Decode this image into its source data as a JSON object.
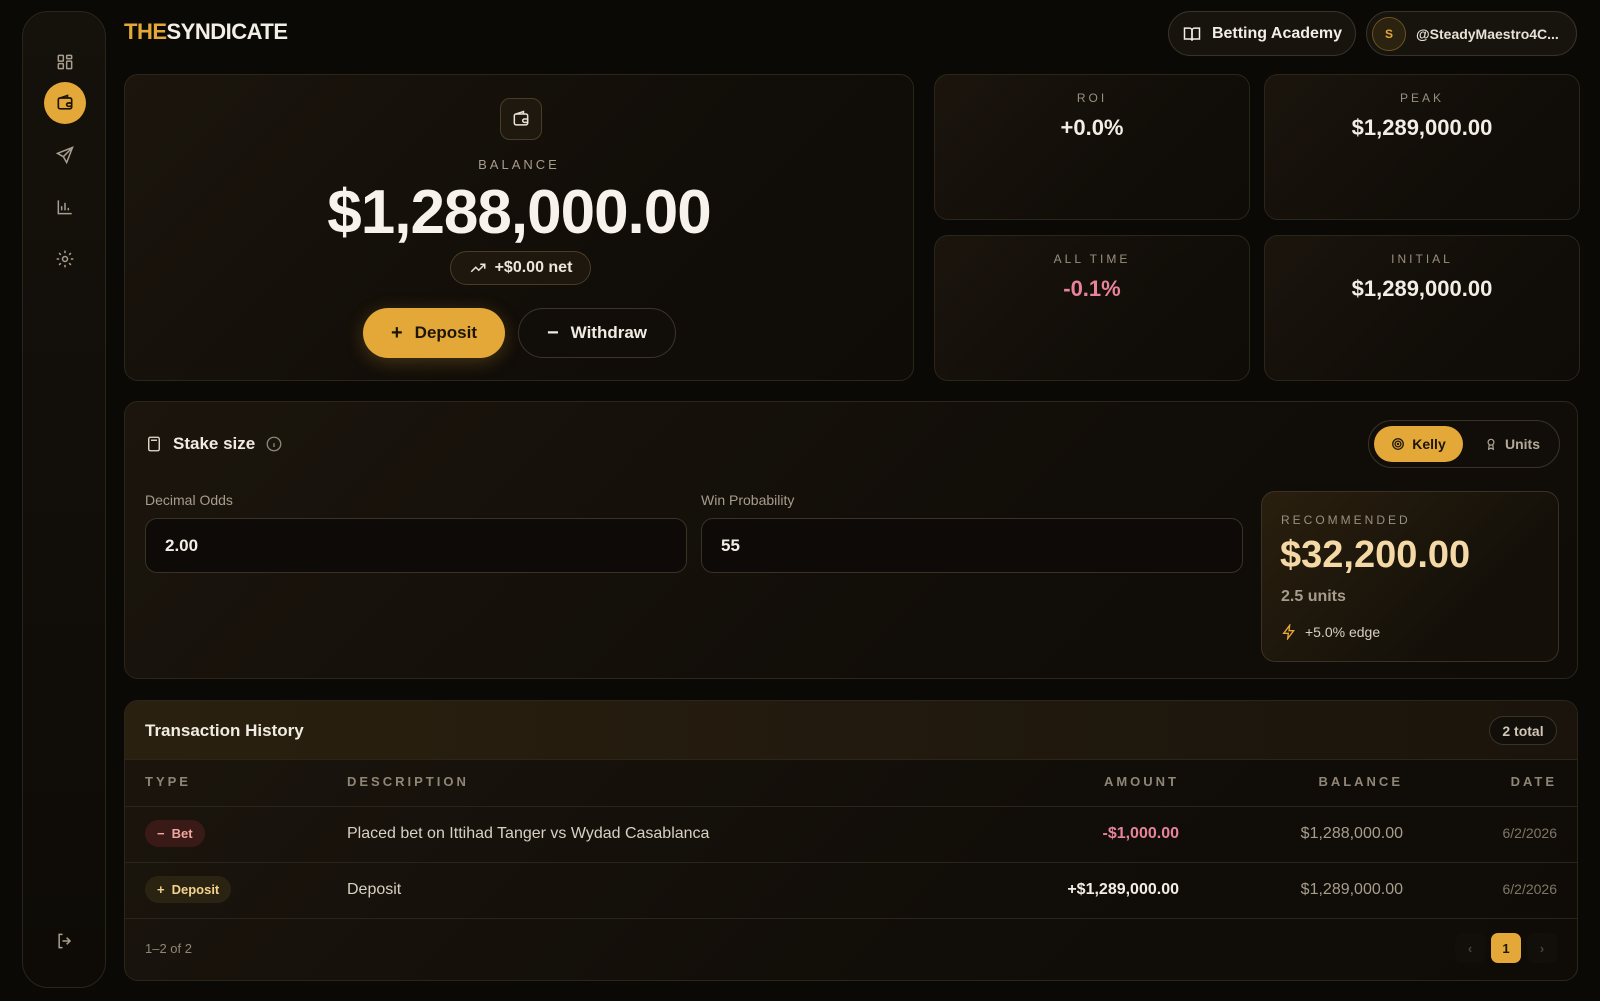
{
  "brand": {
    "part1": "THE",
    "part2": "SYNDICATE"
  },
  "header": {
    "academy_label": "Betting Academy",
    "user_initial": "S",
    "username": "@SteadyMaestro4C..."
  },
  "balance": {
    "label": "BALANCE",
    "value": "$1,288,000.00",
    "net": "+$0.00 net",
    "deposit_label": "Deposit",
    "withdraw_label": "Withdraw"
  },
  "stats": [
    {
      "label": "ROI",
      "value": "+0.0%"
    },
    {
      "label": "PEAK",
      "value": "$1,289,000.00"
    },
    {
      "label": "ALL TIME",
      "value": "-0.1%"
    },
    {
      "label": "INITIAL",
      "value": "$1,289,000.00"
    }
  ],
  "stake": {
    "title": "Stake size",
    "toggle_kelly": "Kelly",
    "toggle_units": "Units",
    "odds_label": "Decimal Odds",
    "odds_value": "2.00",
    "prob_label": "Win Probability",
    "prob_value": "55",
    "rec_label": "RECOMMENDED",
    "rec_value": "$32,200.00",
    "rec_units": "2.5 units",
    "rec_edge": "+5.0% edge"
  },
  "transactions": {
    "title": "Transaction History",
    "total": "2 total",
    "columns": [
      "TYPE",
      "DESCRIPTION",
      "AMOUNT",
      "BALANCE",
      "DATE"
    ],
    "rows": [
      {
        "type": "Bet",
        "description": "Placed bet on Ittihad Tanger vs Wydad Casablanca",
        "amount": "-$1,000.00",
        "balance": "$1,288,000.00",
        "date": "6/2/2026"
      },
      {
        "type": "Deposit",
        "description": "Deposit",
        "amount": "+$1,289,000.00",
        "balance": "$1,289,000.00",
        "date": "6/2/2026"
      }
    ],
    "range": "1–2 of 2",
    "page": "1",
    "prev": "‹",
    "next": "›"
  },
  "colors": {
    "accent": "#e3a838",
    "negative": "#e8839a",
    "background": "#0b0906"
  }
}
